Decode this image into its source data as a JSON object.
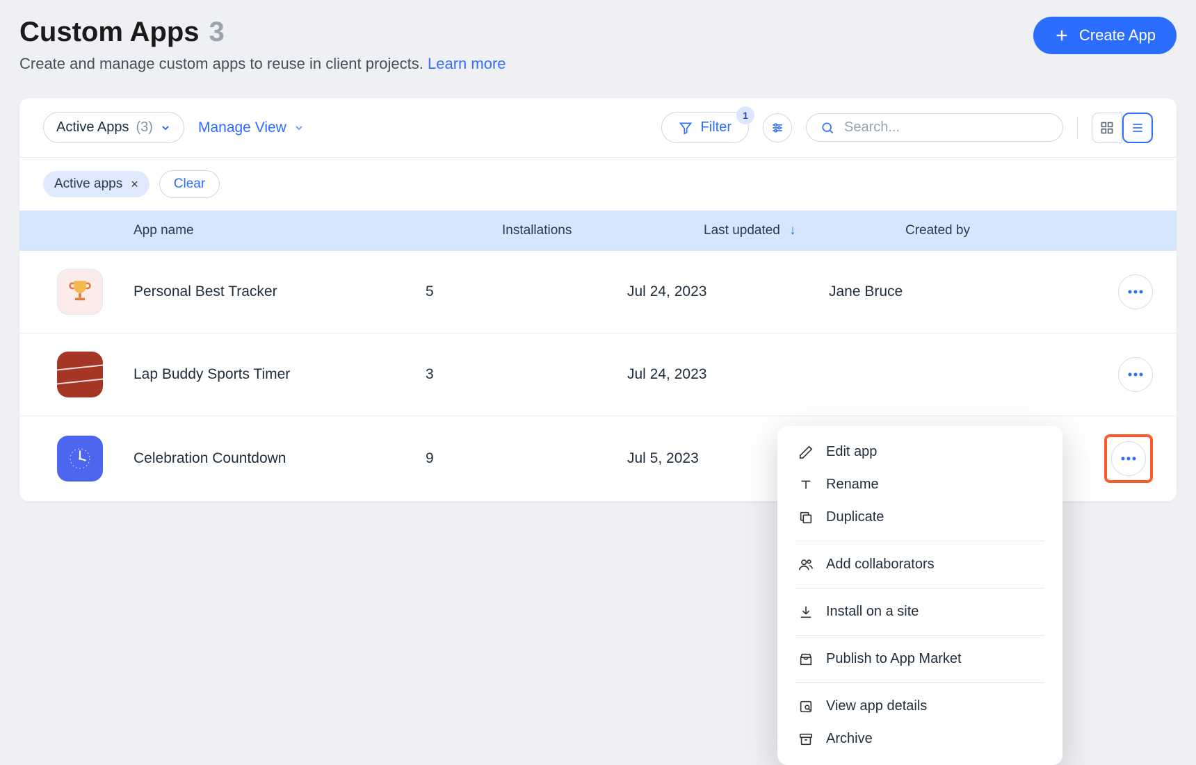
{
  "header": {
    "title": "Custom Apps",
    "count": "3",
    "subtitle": "Create and manage custom apps to reuse in client projects.",
    "learn_more": "Learn more",
    "create_button": "Create App"
  },
  "toolbar": {
    "view_selector": {
      "label": "Active Apps",
      "count": "(3)"
    },
    "manage_view": "Manage View",
    "filter_label": "Filter",
    "filter_count": "1",
    "search_placeholder": "Search..."
  },
  "chips": {
    "active_apps": "Active apps",
    "clear": "Clear"
  },
  "columns": {
    "app_name": "App name",
    "installations": "Installations",
    "last_updated": "Last updated",
    "created_by": "Created by"
  },
  "rows": [
    {
      "name": "Personal Best Tracker",
      "installations": "5",
      "last_updated": "Jul 24, 2023",
      "created_by": "Jane Bruce"
    },
    {
      "name": "Lap Buddy Sports Timer",
      "installations": "3",
      "last_updated": "Jul 24, 2023",
      "created_by": ""
    },
    {
      "name": "Celebration Countdown",
      "installations": "9",
      "last_updated": "Jul 5, 2023",
      "created_by": ""
    }
  ],
  "menu": {
    "edit": "Edit app",
    "rename": "Rename",
    "duplicate": "Duplicate",
    "collaborators": "Add collaborators",
    "install": "Install on a site",
    "publish": "Publish to App Market",
    "details": "View app details",
    "archive": "Archive"
  }
}
